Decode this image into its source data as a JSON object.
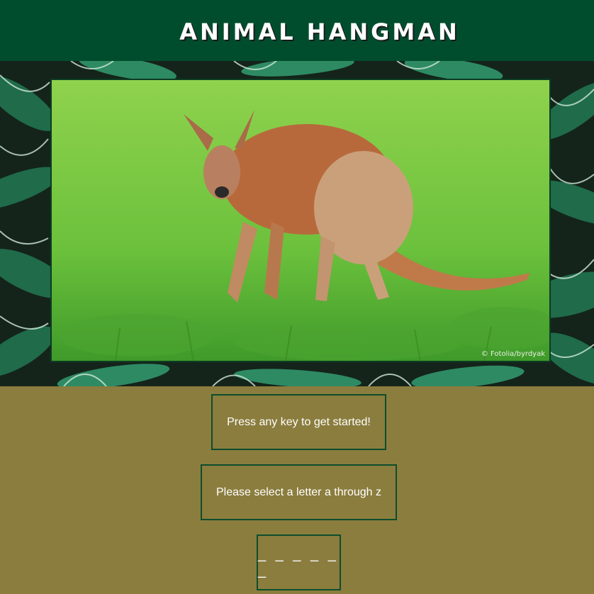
{
  "header": {
    "title": "ANIMAL HANGMAN"
  },
  "image": {
    "subject": "kangaroo",
    "credit": "© Fotolia/byrdyak"
  },
  "game": {
    "start_prompt": "Press any key to get started!",
    "instruction": "Please select a letter a through z",
    "word_display": "_ _ _ _ _ _"
  },
  "colors": {
    "header_bg": "#004d2e",
    "page_bg": "#8b7d3e",
    "box_border": "#0d4d2c"
  }
}
